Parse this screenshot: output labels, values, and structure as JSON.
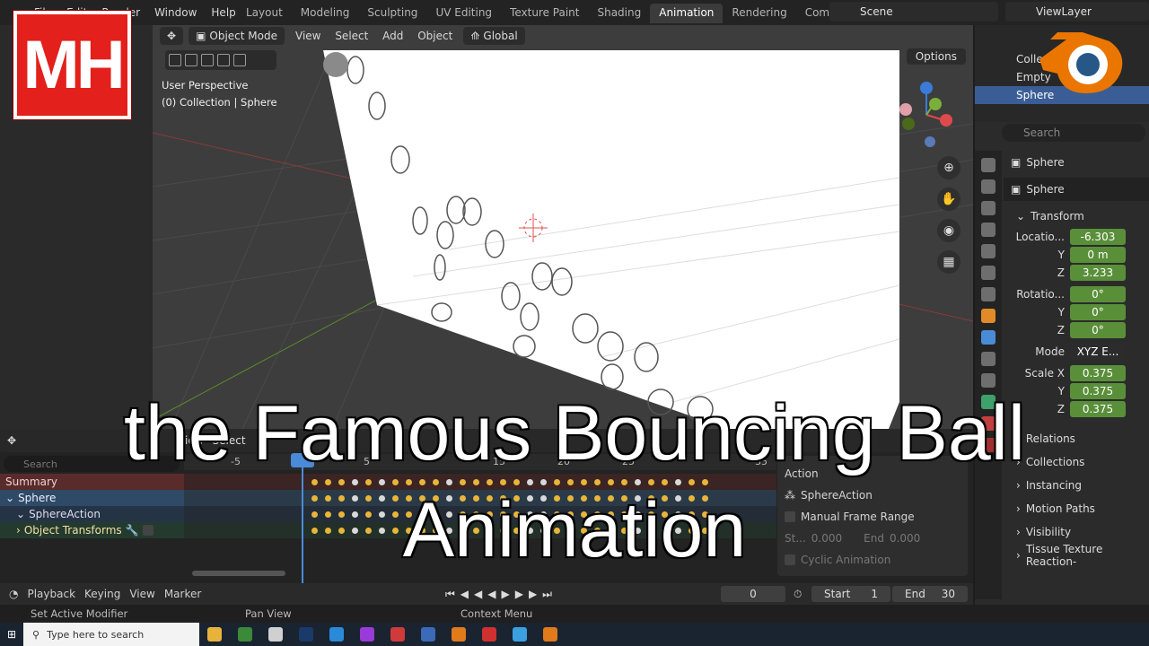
{
  "menu": [
    "File",
    "Edit",
    "Render",
    "Window",
    "Help"
  ],
  "workspaces": [
    "Layout",
    "Modeling",
    "Sculpting",
    "UV Editing",
    "Texture Paint",
    "Shading",
    "Animation",
    "Rendering",
    "Compositing"
  ],
  "active_workspace": "Animation",
  "scene": "Scene",
  "view_layer": "ViewLayer",
  "viewport": {
    "mode": "Object Mode",
    "menus": [
      "View",
      "Select",
      "Add",
      "Object"
    ],
    "orientation": "Global",
    "perspective": "User Perspective",
    "context": "(0) Collection | Sphere",
    "options": "Options"
  },
  "dopesheet": {
    "header_menus": [
      "View",
      "Select"
    ],
    "search_placeholder": "Search",
    "ruler_ticks": [
      "-5",
      "5",
      "15",
      "20",
      "25",
      "35"
    ],
    "channels": [
      "Summary",
      "Sphere",
      "SphereAction",
      "Object Transforms"
    ],
    "action_panel": {
      "title": "Action",
      "action_name": "SphereAction",
      "manual_frame_range": "Manual Frame Range",
      "start_label": "St...",
      "start_value": "0.000",
      "end_label": "End",
      "end_value": "0.000",
      "cyclic": "Cyclic Animation"
    }
  },
  "playback": {
    "menus": [
      "Playback",
      "Keying",
      "View",
      "Marker"
    ],
    "current_frame": "0",
    "start_label": "Start",
    "start": "1",
    "end_label": "End",
    "end": "30"
  },
  "outliner": {
    "rows": [
      "Collection",
      "Empty",
      "Sphere"
    ]
  },
  "properties": {
    "search_placeholder": "Search",
    "object_name": "Sphere",
    "data_name": "Sphere",
    "transform_header": "Transform",
    "location_label": "Locatio...",
    "location": [
      "-6.303",
      "0 m",
      "3.233"
    ],
    "rotation_label": "Rotatio...",
    "rotation": [
      "0°",
      "0°",
      "0°"
    ],
    "mode_label": "Mode",
    "mode_value": "XYZ E...",
    "scale_label": "Scale X",
    "scale": [
      "0.375",
      "0.375",
      "0.375"
    ],
    "axis_labels": [
      "Y",
      "Z"
    ],
    "panels": [
      "Relations",
      "Collections",
      "Instancing",
      "Motion Paths",
      "Visibility",
      "Tissue Texture Reaction-"
    ]
  },
  "statusbar": {
    "left": "Set Active Modifier",
    "middle": "Pan View",
    "right": "Context Menu"
  },
  "taskbar": {
    "search_placeholder": "Type here to search"
  },
  "overlay": {
    "logo_text": "MH",
    "title_line1": "the Famous Bouncing Ball",
    "title_line2": "Animation"
  },
  "colors": {
    "accent_blue": "#4a8bd8",
    "keyframe": "#e8b53a",
    "field_green": "#5a8f3a",
    "logo_red": "#e3201b"
  }
}
